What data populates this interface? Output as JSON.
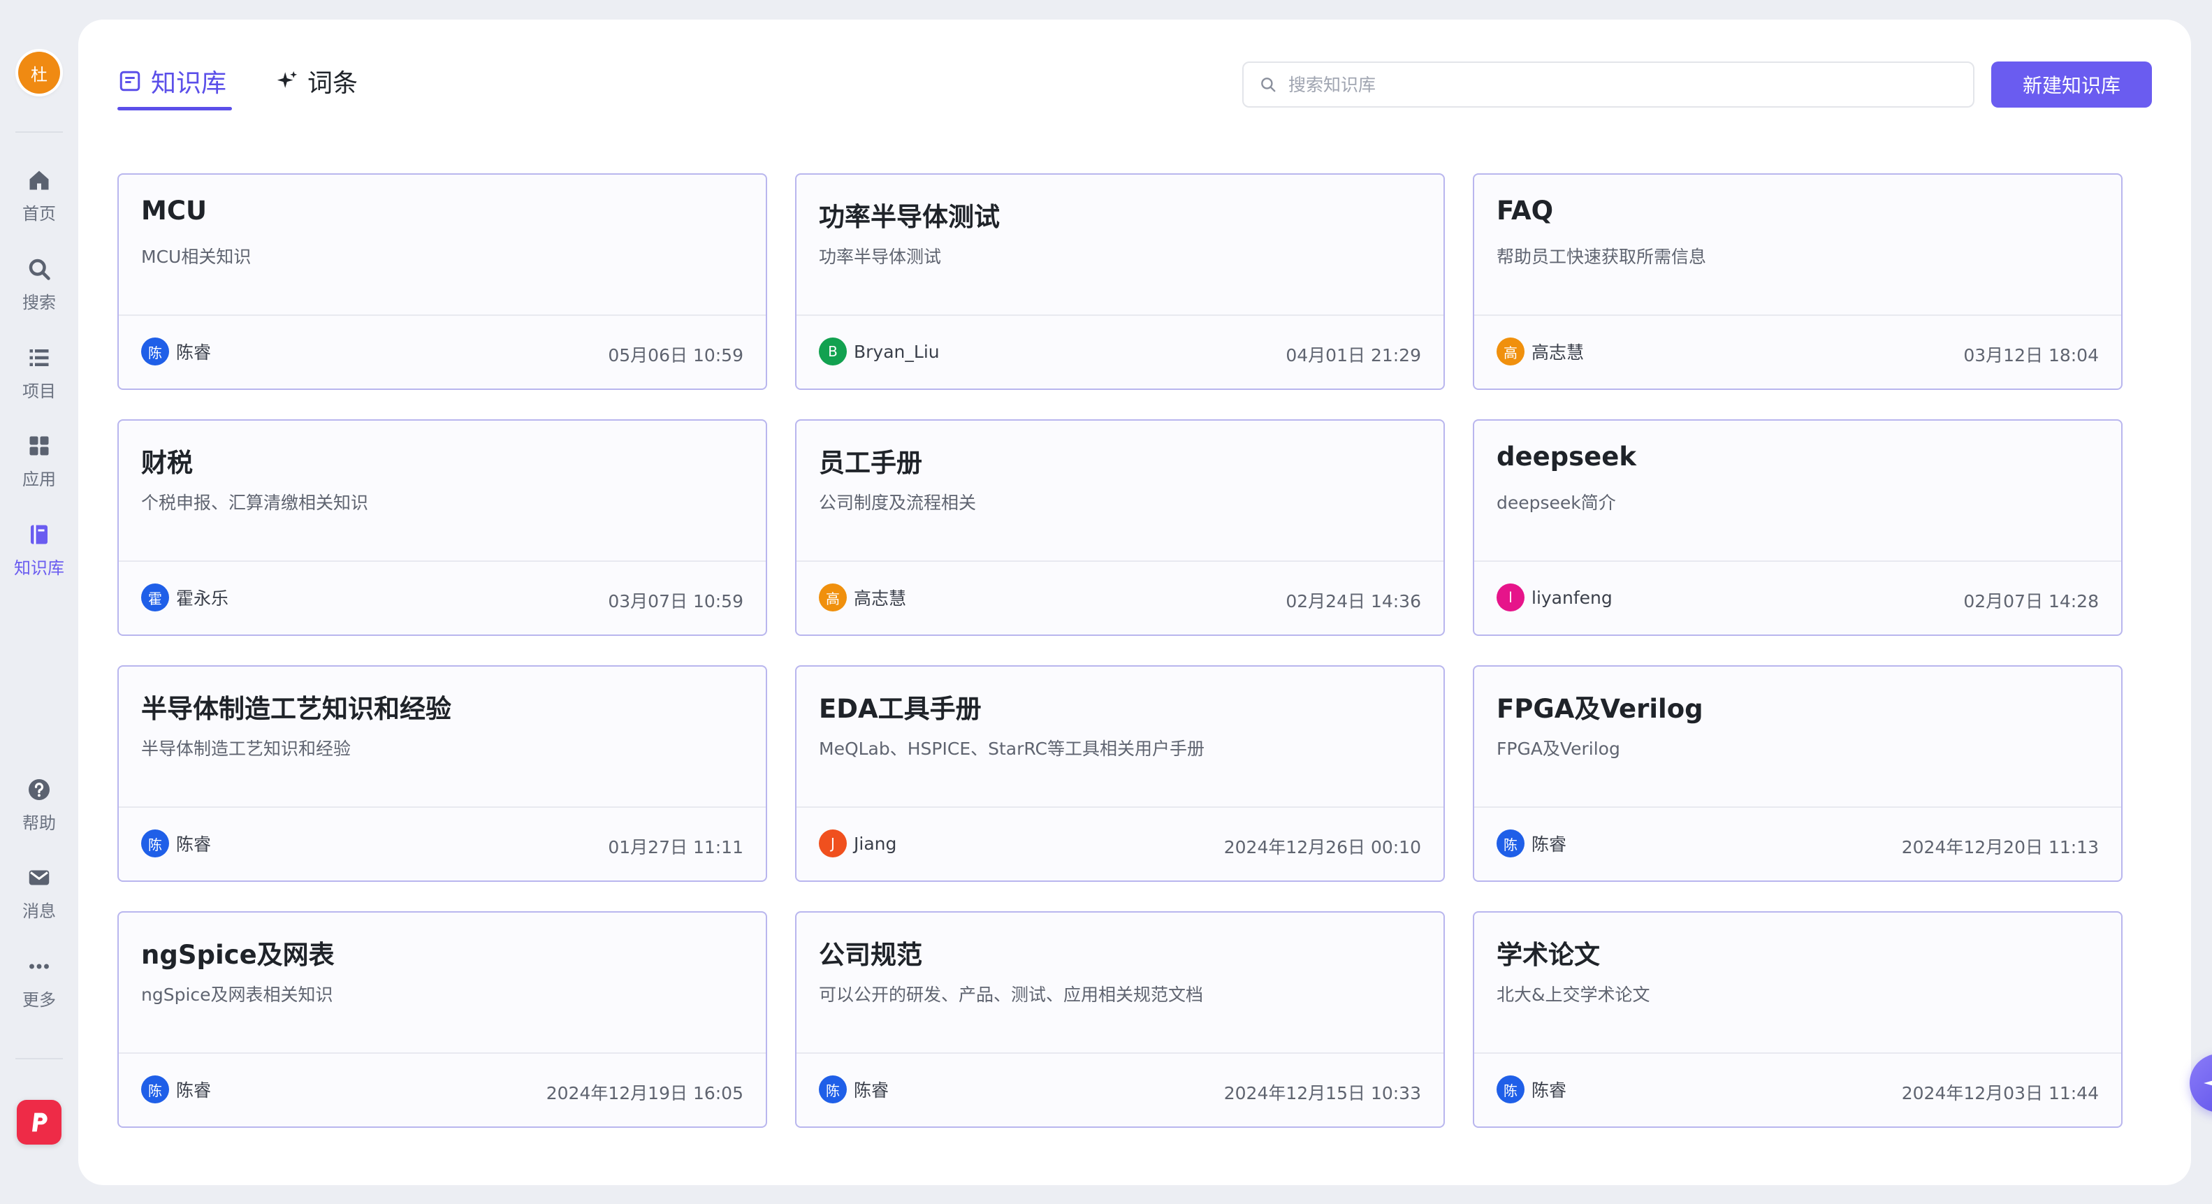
{
  "user": {
    "avatar_text": "杜",
    "avatar_color": "#f08a12"
  },
  "sidebar": {
    "items": [
      {
        "label": "首页",
        "icon": "home-icon"
      },
      {
        "label": "搜索",
        "icon": "search-icon"
      },
      {
        "label": "项目",
        "icon": "list-icon"
      },
      {
        "label": "应用",
        "icon": "grid-icon"
      },
      {
        "label": "知识库",
        "icon": "book-icon",
        "active": true
      }
    ],
    "bottom_items": [
      {
        "label": "帮助",
        "icon": "help-icon"
      },
      {
        "label": "消息",
        "icon": "mail-icon"
      },
      {
        "label": "更多",
        "icon": "more-icon"
      }
    ],
    "brand_logo": "p-logo-icon"
  },
  "header": {
    "tabs": [
      {
        "label": "知识库",
        "icon": "document-icon",
        "active": true
      },
      {
        "label": "词条",
        "icon": "sparkle-icon",
        "active": false
      }
    ],
    "search_placeholder": "搜索知识库",
    "new_button": "新建知识库"
  },
  "colors": {
    "accent": "#6a5cf0",
    "card_border": "#b9b6ee"
  },
  "cards": [
    {
      "title": "MCU",
      "desc": "MCU相关知识",
      "owner": "陈睿",
      "avatar": "陈",
      "avatar_color": "#1f5fe8",
      "time": "05月06日 10:59"
    },
    {
      "title": "功率半导体测试",
      "desc": "功率半导体测试",
      "owner": "Bryan_Liu",
      "avatar": "B",
      "avatar_color": "#12a150",
      "time": "04月01日 21:29"
    },
    {
      "title": "FAQ",
      "desc": "帮助员工快速获取所需信息",
      "owner": "高志慧",
      "avatar": "高",
      "avatar_color": "#f0900d",
      "time": "03月12日 18:04"
    },
    {
      "title": "财税",
      "desc": "个税申报、汇算清缴相关知识",
      "owner": "霍永乐",
      "avatar": "霍",
      "avatar_color": "#1f5fe8",
      "time": "03月07日 10:59"
    },
    {
      "title": "员工手册",
      "desc": "公司制度及流程相关",
      "owner": "高志慧",
      "avatar": "高",
      "avatar_color": "#f0900d",
      "time": "02月24日 14:36"
    },
    {
      "title": "deepseek",
      "desc": "deepseek简介",
      "owner": "liyanfeng",
      "avatar": "l",
      "avatar_color": "#e6148a",
      "time": "02月07日 14:28"
    },
    {
      "title": "半导体制造工艺知识和经验",
      "desc": "半导体制造工艺知识和经验",
      "owner": "陈睿",
      "avatar": "陈",
      "avatar_color": "#1f5fe8",
      "time": "01月27日 11:11"
    },
    {
      "title": "EDA工具手册",
      "desc": "MeQLab、HSPICE、StarRC等工具相关用户手册",
      "owner": "Jiang",
      "avatar": "J",
      "avatar_color": "#f0501e",
      "time": "2024年12月26日 00:10"
    },
    {
      "title": "FPGA及Verilog",
      "desc": "FPGA及Verilog",
      "owner": "陈睿",
      "avatar": "陈",
      "avatar_color": "#1f5fe8",
      "time": "2024年12月20日 11:13"
    },
    {
      "title": "ngSpice及网表",
      "desc": "ngSpice及网表相关知识",
      "owner": "陈睿",
      "avatar": "陈",
      "avatar_color": "#1f5fe8",
      "time": "2024年12月19日 16:05"
    },
    {
      "title": "公司规范",
      "desc": "可以公开的研发、产品、测试、应用相关规范文档",
      "owner": "陈睿",
      "avatar": "陈",
      "avatar_color": "#1f5fe8",
      "time": "2024年12月15日 10:33"
    },
    {
      "title": "学术论文",
      "desc": "北大&上交学术论文",
      "owner": "陈睿",
      "avatar": "陈",
      "avatar_color": "#1f5fe8",
      "time": "2024年12月03日 11:44"
    }
  ]
}
